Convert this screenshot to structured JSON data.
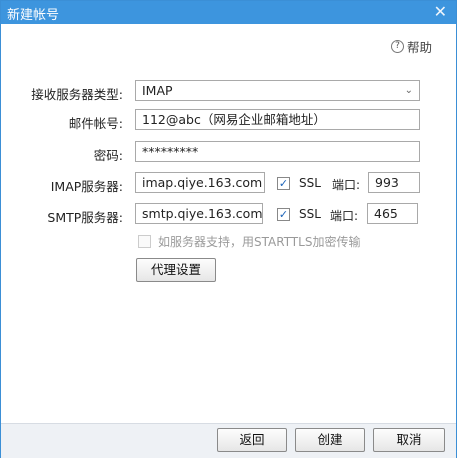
{
  "window": {
    "title": "新建帐号",
    "close_symbol": "✕"
  },
  "help": {
    "label": "帮助",
    "icon_glyph": "?"
  },
  "form": {
    "receive_type": {
      "label": "接收服务器类型:",
      "value": "IMAP",
      "arrow_glyph": "⌄"
    },
    "email": {
      "label": "邮件帐号:",
      "value": "112@abc（网易企业邮箱地址）"
    },
    "password": {
      "label": "密码:",
      "value": "*********"
    },
    "imap": {
      "label": "IMAP服务器:",
      "server": "imap.qiye.163.com",
      "ssl_label": "SSL",
      "ssl_checked": true,
      "port_label": "端口:",
      "port": "993"
    },
    "smtp": {
      "label": "SMTP服务器:",
      "server": "smtp.qiye.163.com",
      "ssl_label": "SSL",
      "ssl_checked": true,
      "port_label": "端口:",
      "port": "465"
    },
    "starttls": {
      "label": "如服务器支持，用STARTTLS加密传输",
      "checked": false,
      "enabled": false
    },
    "proxy_button": "代理设置"
  },
  "footer": {
    "back": "返回",
    "create": "创建",
    "cancel": "取消"
  },
  "colors": {
    "titlebar": "#3d95de",
    "border": "#3b8fd6",
    "footer_bg": "#eef1f5"
  },
  "check_glyph": "✓"
}
